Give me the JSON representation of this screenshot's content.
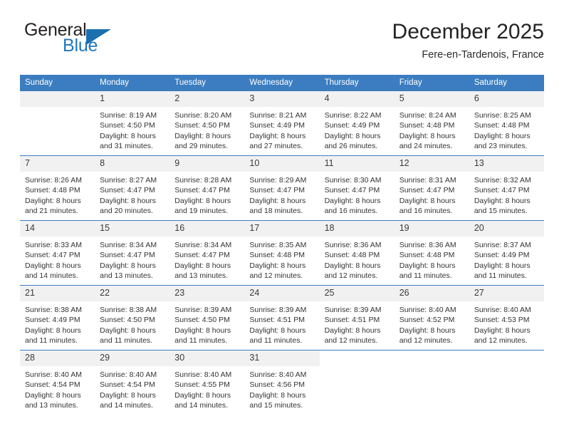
{
  "brand": {
    "name_top": "General",
    "name_bottom": "Blue",
    "triangle_icon": "triangle-icon",
    "color_dark": "#231f20",
    "color_blue": "#2277bb"
  },
  "header": {
    "title": "December 2025",
    "subtitle": "Fere-en-Tardenois, France"
  },
  "theme": {
    "header_row_bg": "#3b7dc0",
    "daynum_bg": "#f1f1f1",
    "text": "#333333"
  },
  "calendar": {
    "weekday_headers": [
      "Sunday",
      "Monday",
      "Tuesday",
      "Wednesday",
      "Thursday",
      "Friday",
      "Saturday"
    ],
    "weeks": [
      [
        {
          "day": "",
          "lines": []
        },
        {
          "day": "1",
          "lines": [
            "Sunrise: 8:19 AM",
            "Sunset: 4:50 PM",
            "Daylight: 8 hours",
            "and 31 minutes."
          ]
        },
        {
          "day": "2",
          "lines": [
            "Sunrise: 8:20 AM",
            "Sunset: 4:50 PM",
            "Daylight: 8 hours",
            "and 29 minutes."
          ]
        },
        {
          "day": "3",
          "lines": [
            "Sunrise: 8:21 AM",
            "Sunset: 4:49 PM",
            "Daylight: 8 hours",
            "and 27 minutes."
          ]
        },
        {
          "day": "4",
          "lines": [
            "Sunrise: 8:22 AM",
            "Sunset: 4:49 PM",
            "Daylight: 8 hours",
            "and 26 minutes."
          ]
        },
        {
          "day": "5",
          "lines": [
            "Sunrise: 8:24 AM",
            "Sunset: 4:48 PM",
            "Daylight: 8 hours",
            "and 24 minutes."
          ]
        },
        {
          "day": "6",
          "lines": [
            "Sunrise: 8:25 AM",
            "Sunset: 4:48 PM",
            "Daylight: 8 hours",
            "and 23 minutes."
          ]
        }
      ],
      [
        {
          "day": "7",
          "lines": [
            "Sunrise: 8:26 AM",
            "Sunset: 4:48 PM",
            "Daylight: 8 hours",
            "and 21 minutes."
          ]
        },
        {
          "day": "8",
          "lines": [
            "Sunrise: 8:27 AM",
            "Sunset: 4:47 PM",
            "Daylight: 8 hours",
            "and 20 minutes."
          ]
        },
        {
          "day": "9",
          "lines": [
            "Sunrise: 8:28 AM",
            "Sunset: 4:47 PM",
            "Daylight: 8 hours",
            "and 19 minutes."
          ]
        },
        {
          "day": "10",
          "lines": [
            "Sunrise: 8:29 AM",
            "Sunset: 4:47 PM",
            "Daylight: 8 hours",
            "and 18 minutes."
          ]
        },
        {
          "day": "11",
          "lines": [
            "Sunrise: 8:30 AM",
            "Sunset: 4:47 PM",
            "Daylight: 8 hours",
            "and 16 minutes."
          ]
        },
        {
          "day": "12",
          "lines": [
            "Sunrise: 8:31 AM",
            "Sunset: 4:47 PM",
            "Daylight: 8 hours",
            "and 16 minutes."
          ]
        },
        {
          "day": "13",
          "lines": [
            "Sunrise: 8:32 AM",
            "Sunset: 4:47 PM",
            "Daylight: 8 hours",
            "and 15 minutes."
          ]
        }
      ],
      [
        {
          "day": "14",
          "lines": [
            "Sunrise: 8:33 AM",
            "Sunset: 4:47 PM",
            "Daylight: 8 hours",
            "and 14 minutes."
          ]
        },
        {
          "day": "15",
          "lines": [
            "Sunrise: 8:34 AM",
            "Sunset: 4:47 PM",
            "Daylight: 8 hours",
            "and 13 minutes."
          ]
        },
        {
          "day": "16",
          "lines": [
            "Sunrise: 8:34 AM",
            "Sunset: 4:47 PM",
            "Daylight: 8 hours",
            "and 13 minutes."
          ]
        },
        {
          "day": "17",
          "lines": [
            "Sunrise: 8:35 AM",
            "Sunset: 4:48 PM",
            "Daylight: 8 hours",
            "and 12 minutes."
          ]
        },
        {
          "day": "18",
          "lines": [
            "Sunrise: 8:36 AM",
            "Sunset: 4:48 PM",
            "Daylight: 8 hours",
            "and 12 minutes."
          ]
        },
        {
          "day": "19",
          "lines": [
            "Sunrise: 8:36 AM",
            "Sunset: 4:48 PM",
            "Daylight: 8 hours",
            "and 11 minutes."
          ]
        },
        {
          "day": "20",
          "lines": [
            "Sunrise: 8:37 AM",
            "Sunset: 4:49 PM",
            "Daylight: 8 hours",
            "and 11 minutes."
          ]
        }
      ],
      [
        {
          "day": "21",
          "lines": [
            "Sunrise: 8:38 AM",
            "Sunset: 4:49 PM",
            "Daylight: 8 hours",
            "and 11 minutes."
          ]
        },
        {
          "day": "22",
          "lines": [
            "Sunrise: 8:38 AM",
            "Sunset: 4:50 PM",
            "Daylight: 8 hours",
            "and 11 minutes."
          ]
        },
        {
          "day": "23",
          "lines": [
            "Sunrise: 8:39 AM",
            "Sunset: 4:50 PM",
            "Daylight: 8 hours",
            "and 11 minutes."
          ]
        },
        {
          "day": "24",
          "lines": [
            "Sunrise: 8:39 AM",
            "Sunset: 4:51 PM",
            "Daylight: 8 hours",
            "and 11 minutes."
          ]
        },
        {
          "day": "25",
          "lines": [
            "Sunrise: 8:39 AM",
            "Sunset: 4:51 PM",
            "Daylight: 8 hours",
            "and 12 minutes."
          ]
        },
        {
          "day": "26",
          "lines": [
            "Sunrise: 8:40 AM",
            "Sunset: 4:52 PM",
            "Daylight: 8 hours",
            "and 12 minutes."
          ]
        },
        {
          "day": "27",
          "lines": [
            "Sunrise: 8:40 AM",
            "Sunset: 4:53 PM",
            "Daylight: 8 hours",
            "and 12 minutes."
          ]
        }
      ],
      [
        {
          "day": "28",
          "lines": [
            "Sunrise: 8:40 AM",
            "Sunset: 4:54 PM",
            "Daylight: 8 hours",
            "and 13 minutes."
          ]
        },
        {
          "day": "29",
          "lines": [
            "Sunrise: 8:40 AM",
            "Sunset: 4:54 PM",
            "Daylight: 8 hours",
            "and 14 minutes."
          ]
        },
        {
          "day": "30",
          "lines": [
            "Sunrise: 8:40 AM",
            "Sunset: 4:55 PM",
            "Daylight: 8 hours",
            "and 14 minutes."
          ]
        },
        {
          "day": "31",
          "lines": [
            "Sunrise: 8:40 AM",
            "Sunset: 4:56 PM",
            "Daylight: 8 hours",
            "and 15 minutes."
          ]
        },
        {
          "day": "",
          "lines": []
        },
        {
          "day": "",
          "lines": []
        },
        {
          "day": "",
          "lines": []
        }
      ]
    ]
  }
}
